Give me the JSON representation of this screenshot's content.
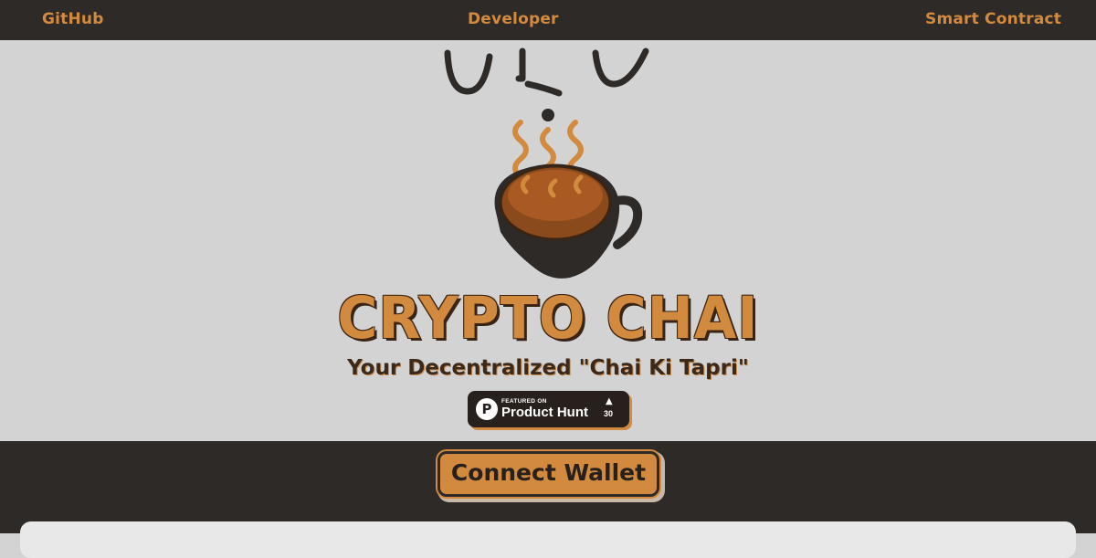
{
  "nav": {
    "github": "GitHub",
    "developer": "Developer",
    "smart_contract": "Smart Contract"
  },
  "hero": {
    "title": "CRYPTO CHAI",
    "subtitle": "Your Decentralized \"Chai Ki Tapri\""
  },
  "product_hunt": {
    "featured": "FEATURED ON",
    "name": "Product Hunt",
    "logo_letter": "P",
    "upvotes": "30",
    "arrow": "▲"
  },
  "wallet": {
    "connect_label": "Connect Wallet"
  },
  "colors": {
    "dark": "#2d2a27",
    "accent": "#d28a3f",
    "background": "#d3d3d3"
  }
}
